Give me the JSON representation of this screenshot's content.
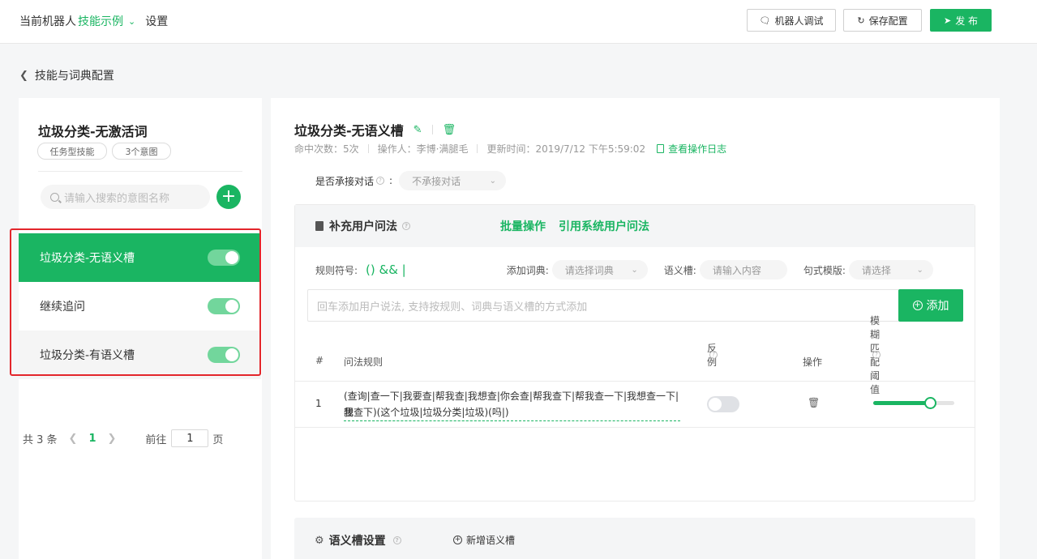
{
  "topbar": {
    "crumb_robot": "当前机器人",
    "crumb_skill": "技能示例",
    "crumb_settings": "设置",
    "debug_label": "机器人调试",
    "save_label": "保存配置",
    "publish_label": "发 布"
  },
  "back": {
    "label": "技能与词典配置"
  },
  "skill": {
    "title": "垃圾分类-无激活词",
    "tags": [
      "任务型技能",
      "3个意图"
    ],
    "search_placeholder": "请输入搜索的意图名称"
  },
  "intents": [
    {
      "label": "垃圾分类-无语义槽",
      "enabled": true,
      "active": true
    },
    {
      "label": "继续追问",
      "enabled": true,
      "active": false
    },
    {
      "label": "垃圾分类-有语义槽",
      "enabled": true,
      "active": false
    }
  ],
  "pager": {
    "total": "共 3 条",
    "current": "1",
    "goto_label": "前往",
    "goto_value": "1",
    "page_suffix": "页"
  },
  "intent_detail": {
    "title": "垃圾分类-无语义槽",
    "hits": "命中次数：5次",
    "operator": "操作人：李博·满腿毛",
    "updated": "更新时间：2019/7/12 下午5:59:02",
    "log_link": "查看操作日志",
    "accept_label": "是否承接对话",
    "accept_value": "不承接对话"
  },
  "utterances": {
    "header": "补充用户问法",
    "batch_link": "批量操作",
    "system_link": "引用系统用户问法",
    "rule_symbol_label": "规则符号:",
    "rule_symbols": "() && |",
    "dict_label": "添加词典:",
    "dict_placeholder": "请选择词典",
    "slot_label": "语义槽:",
    "slot_placeholder": "请输入内容",
    "template_label": "句式模版:",
    "template_placeholder": "请选择",
    "input_placeholder": "回车添加用户说法, 支持按规则、词典与语义槽的方式添加",
    "add_label": "添加",
    "columns": [
      "#",
      "问法规则",
      "反例",
      "操作",
      "模糊匹配阈值"
    ],
    "rows": [
      {
        "index": "1",
        "rule_line1": "(查询|查一下|我要查|帮我查|我想查|你会查|帮我查下|帮我查一下|我想查一下|我",
        "rule_line2": "想查下)(这个垃圾|垃圾分类|垃圾)(吗|)",
        "counter_example": false,
        "threshold": 0.7
      }
    ]
  },
  "slots": {
    "header": "语义槽设置",
    "new_label": "新增语义槽"
  },
  "colors": {
    "accent": "#1ab562",
    "highlight_border": "#e3262b"
  }
}
